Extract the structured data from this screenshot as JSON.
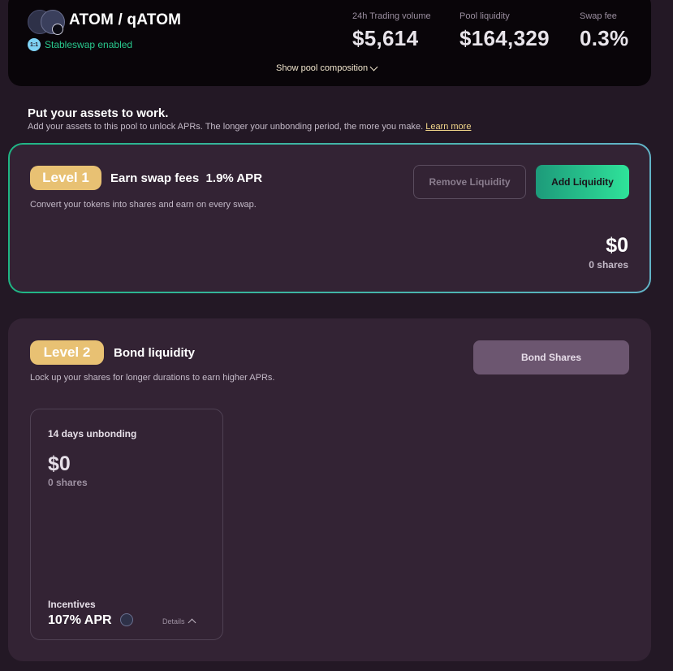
{
  "header": {
    "pool_name": "ATOM / qATOM",
    "stableswap_badge": "1:1",
    "stableswap_text": "Stableswap enabled",
    "stats": [
      {
        "label": "24h Trading volume",
        "value": "$5,614"
      },
      {
        "label": "Pool liquidity",
        "value": "$164,329"
      },
      {
        "label": "Swap fee",
        "value": "0.3%"
      }
    ],
    "show_composition": "Show pool composition"
  },
  "intro": {
    "title": "Put your assets to work.",
    "subtitle": "Add your assets to this pool to unlock APRs. The longer your unbonding period, the more you make.",
    "learn_more": "Learn more"
  },
  "level1": {
    "pill": "Level 1",
    "title": "Earn swap fees  1.9% APR",
    "description": "Convert your tokens into shares and earn on every swap.",
    "remove_button": "Remove Liquidity",
    "add_button": "Add Liquidity",
    "amount": "$0",
    "shares": "0 shares"
  },
  "level2": {
    "pill": "Level 2",
    "title": "Bond liquidity",
    "description": "Lock up your shares for longer durations to earn higher APRs.",
    "bond_button": "Bond Shares",
    "bond_card": {
      "title": "14 days unbonding",
      "amount": "$0",
      "shares": "0 shares",
      "incentives_label": "Incentives",
      "apr": "107% APR",
      "details": "Details"
    }
  },
  "colors": {
    "background": "#231825",
    "accent_gold": "#e8c173",
    "accent_green": "#2fe39a",
    "card": "#332334"
  }
}
